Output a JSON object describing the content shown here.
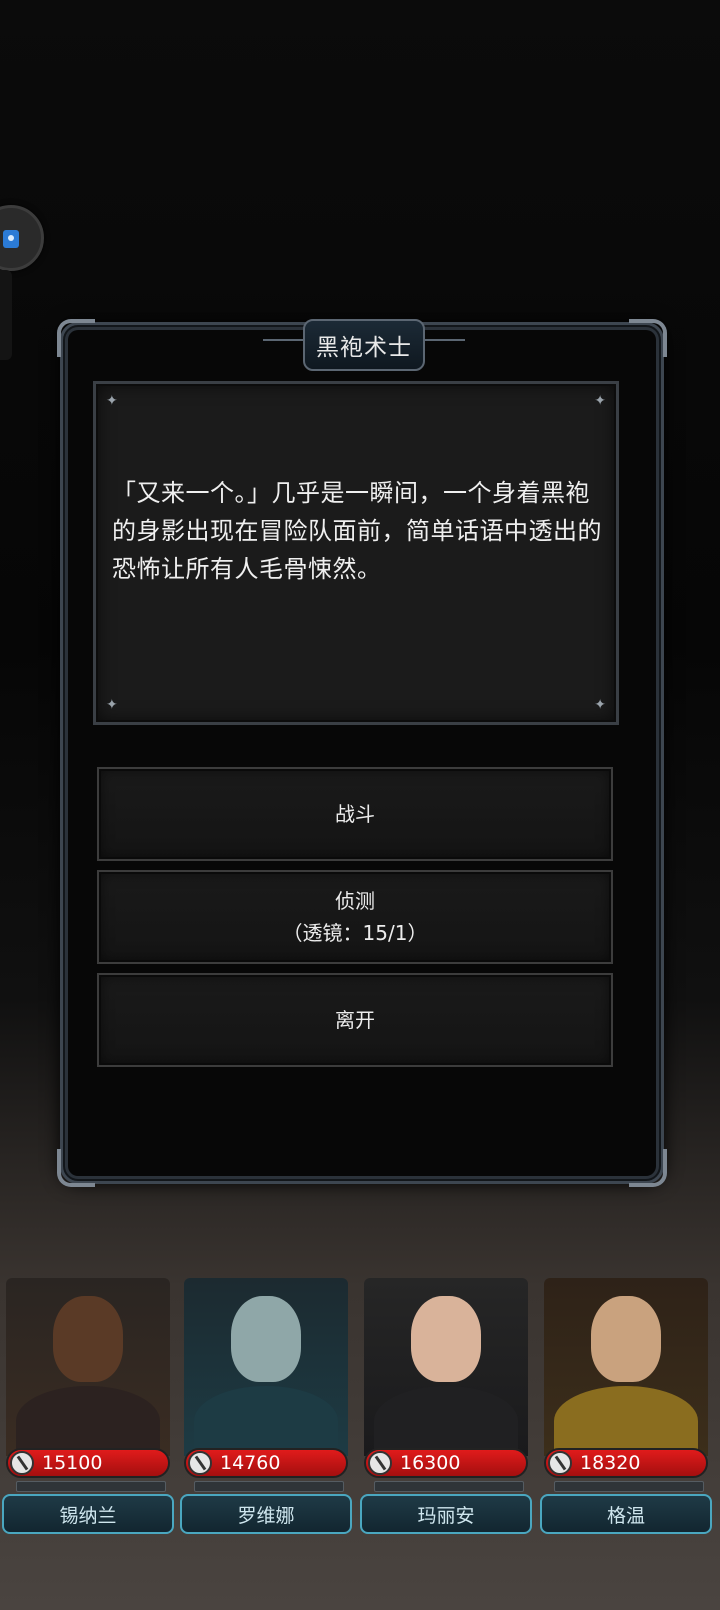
{
  "dialog": {
    "title": "黑袍术士",
    "story": "「又来一个。」几乎是一瞬间，一个身着黑袍的身影出现在冒险队面前，简单话语中透出的恐怖让所有人毛骨悚然。"
  },
  "choices": [
    {
      "label": "战斗",
      "sub": ""
    },
    {
      "label": "侦测",
      "sub": "（透镜：15/1）"
    },
    {
      "label": "离开",
      "sub": ""
    }
  ],
  "party": [
    {
      "name": "锡纳兰",
      "hp": "15100",
      "skin": "#5a3a26",
      "cloth": "#2c2220"
    },
    {
      "name": "罗维娜",
      "hp": "14760",
      "skin": "#8fa7a8",
      "cloth": "#1d3b44"
    },
    {
      "name": "玛丽安",
      "hp": "16300",
      "skin": "#d9b39a",
      "cloth": "#202022"
    },
    {
      "name": "格温",
      "hp": "18320",
      "skin": "#c9a27e",
      "cloth": "#8a6d1f"
    }
  ],
  "colors": {
    "hp_bar": "#d01616",
    "name_plate_border": "#4aa7c0",
    "frame": "#3d4650"
  }
}
